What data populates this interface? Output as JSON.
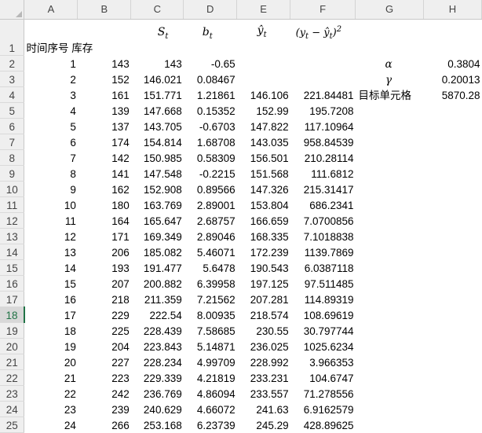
{
  "columns": [
    "A",
    "B",
    "C",
    "D",
    "E",
    "F",
    "G",
    "H"
  ],
  "header_row": {
    "row": "1",
    "A": "时间序号",
    "B": "库存",
    "C_math": {
      "base": "S",
      "sub": "t"
    },
    "D_math": {
      "base": "b",
      "sub": "t"
    },
    "E_math": {
      "base": "ŷ",
      "sub": "t"
    },
    "F_math": "(y_t − ŷ_t)^2"
  },
  "rows": [
    {
      "row": "2",
      "A": "1",
      "B": "143",
      "C": "143",
      "D": "-0.65",
      "E": "",
      "F": "",
      "G": "α",
      "H": "0.3804"
    },
    {
      "row": "3",
      "A": "2",
      "B": "152",
      "C": "146.021",
      "D": "0.08467",
      "E": "",
      "F": "",
      "G": "γ",
      "H": "0.20013"
    },
    {
      "row": "4",
      "A": "3",
      "B": "161",
      "C": "151.771",
      "D": "1.21861",
      "E": "146.106",
      "F": "221.84481",
      "G": "目标单元格",
      "H": "5870.28"
    },
    {
      "row": "5",
      "A": "4",
      "B": "139",
      "C": "147.668",
      "D": "0.15352",
      "E": "152.99",
      "F": "195.7208",
      "G": "",
      "H": ""
    },
    {
      "row": "6",
      "A": "5",
      "B": "137",
      "C": "143.705",
      "D": "-0.6703",
      "E": "147.822",
      "F": "117.10964",
      "G": "",
      "H": ""
    },
    {
      "row": "7",
      "A": "6",
      "B": "174",
      "C": "154.814",
      "D": "1.68708",
      "E": "143.035",
      "F": "958.84539",
      "G": "",
      "H": ""
    },
    {
      "row": "8",
      "A": "7",
      "B": "142",
      "C": "150.985",
      "D": "0.58309",
      "E": "156.501",
      "F": "210.28114",
      "G": "",
      "H": ""
    },
    {
      "row": "9",
      "A": "8",
      "B": "141",
      "C": "147.548",
      "D": "-0.2215",
      "E": "151.568",
      "F": "111.6812",
      "G": "",
      "H": ""
    },
    {
      "row": "10",
      "A": "9",
      "B": "162",
      "C": "152.908",
      "D": "0.89566",
      "E": "147.326",
      "F": "215.31417",
      "G": "",
      "H": ""
    },
    {
      "row": "11",
      "A": "10",
      "B": "180",
      "C": "163.769",
      "D": "2.89001",
      "E": "153.804",
      "F": "686.2341",
      "G": "",
      "H": ""
    },
    {
      "row": "12",
      "A": "11",
      "B": "164",
      "C": "165.647",
      "D": "2.68757",
      "E": "166.659",
      "F": "7.0700856",
      "G": "",
      "H": ""
    },
    {
      "row": "13",
      "A": "12",
      "B": "171",
      "C": "169.349",
      "D": "2.89046",
      "E": "168.335",
      "F": "7.1018838",
      "G": "",
      "H": ""
    },
    {
      "row": "14",
      "A": "13",
      "B": "206",
      "C": "185.082",
      "D": "5.46071",
      "E": "172.239",
      "F": "1139.7869",
      "G": "",
      "H": ""
    },
    {
      "row": "15",
      "A": "14",
      "B": "193",
      "C": "191.477",
      "D": "5.6478",
      "E": "190.543",
      "F": "6.0387118",
      "G": "",
      "H": ""
    },
    {
      "row": "16",
      "A": "15",
      "B": "207",
      "C": "200.882",
      "D": "6.39958",
      "E": "197.125",
      "F": "97.511485",
      "G": "",
      "H": ""
    },
    {
      "row": "17",
      "A": "16",
      "B": "218",
      "C": "211.359",
      "D": "7.21562",
      "E": "207.281",
      "F": "114.89319",
      "G": "",
      "H": ""
    },
    {
      "row": "18",
      "A": "17",
      "B": "229",
      "C": "222.54",
      "D": "8.00935",
      "E": "218.574",
      "F": "108.69619",
      "G": "",
      "H": ""
    },
    {
      "row": "19",
      "A": "18",
      "B": "225",
      "C": "228.439",
      "D": "7.58685",
      "E": "230.55",
      "F": "30.797744",
      "G": "",
      "H": ""
    },
    {
      "row": "20",
      "A": "19",
      "B": "204",
      "C": "223.843",
      "D": "5.14871",
      "E": "236.025",
      "F": "1025.6234",
      "G": "",
      "H": ""
    },
    {
      "row": "21",
      "A": "20",
      "B": "227",
      "C": "228.234",
      "D": "4.99709",
      "E": "228.992",
      "F": "3.966353",
      "G": "",
      "H": ""
    },
    {
      "row": "22",
      "A": "21",
      "B": "223",
      "C": "229.339",
      "D": "4.21819",
      "E": "233.231",
      "F": "104.6747",
      "G": "",
      "H": ""
    },
    {
      "row": "23",
      "A": "22",
      "B": "242",
      "C": "236.769",
      "D": "4.86094",
      "E": "233.557",
      "F": "71.278556",
      "G": "",
      "H": ""
    },
    {
      "row": "24",
      "A": "23",
      "B": "239",
      "C": "240.629",
      "D": "4.66072",
      "E": "241.63",
      "F": "6.9162579",
      "G": "",
      "H": ""
    },
    {
      "row": "25",
      "A": "24",
      "B": "266",
      "C": "253.168",
      "D": "6.23739",
      "E": "245.29",
      "F": "428.89625",
      "G": "",
      "H": ""
    }
  ],
  "selected_row": "18",
  "colors": {
    "header_bg": "#efefef",
    "selected_accent": "#217346",
    "gridline": "#dadada"
  }
}
